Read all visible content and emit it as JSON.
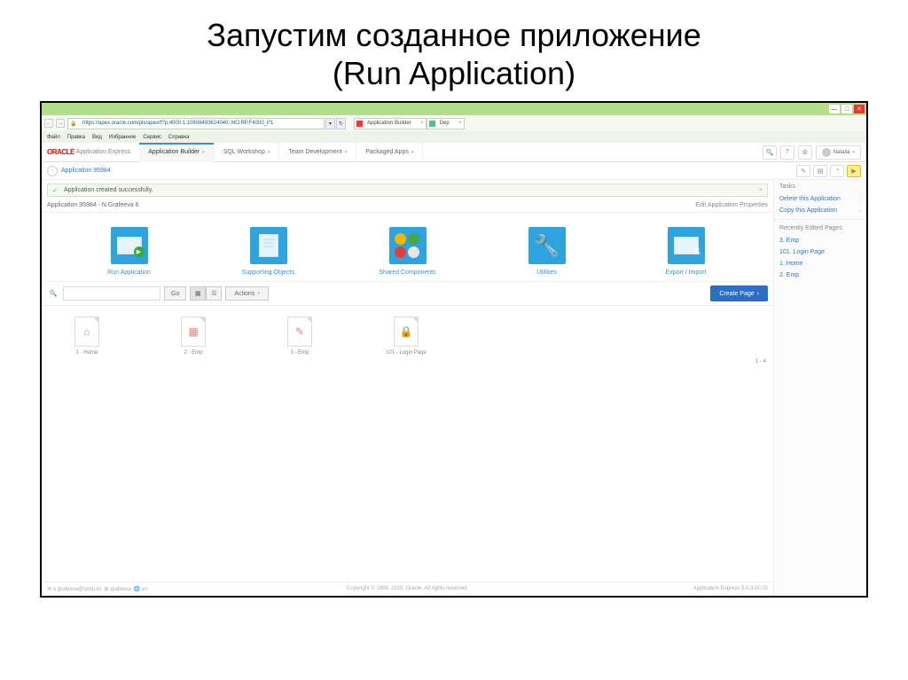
{
  "slide": {
    "title_ru": "Запустим созданное приложение",
    "title_en": "(Run Application)"
  },
  "browser": {
    "url": "https://apex.oracle.com/pls/apex/f?p;4000:1:10808493624040::NO:RP,F4000_P1",
    "tabs": [
      {
        "label": "Application Builder"
      },
      {
        "label": "Dep"
      }
    ],
    "menu": [
      "Файл",
      "Правка",
      "Вид",
      "Избранное",
      "Сервис",
      "Справка"
    ]
  },
  "apex": {
    "logo": "ORACLE",
    "product": "Application Express",
    "tabs": [
      {
        "label": "Application Builder"
      },
      {
        "label": "SQL Workshop"
      },
      {
        "label": "Team Development"
      },
      {
        "label": "Packaged Apps"
      }
    ],
    "user": "Natalia",
    "breadcrumb": "Application 95984",
    "success": "Application created successfully.",
    "app_title": "Application 95984 - N.Grafeeva 6",
    "edit_props": "Edit Application Properties",
    "tiles": [
      {
        "label": "Run Application"
      },
      {
        "label": "Supporting Objects"
      },
      {
        "label": "Shared Components"
      },
      {
        "label": "Utilities"
      },
      {
        "label": "Export / Import"
      }
    ],
    "toolbar": {
      "go": "Go",
      "actions": "Actions",
      "create": "Create Page"
    },
    "pages": [
      {
        "label": "1 - Home"
      },
      {
        "label": "2 - Emp"
      },
      {
        "label": "3 - Emp"
      },
      {
        "label": "101 - Login Page"
      }
    ],
    "page_count": "1 - 4",
    "footer": {
      "left_user": "n.grafeeva@spbu.ru",
      "left_ws": "grafeeva",
      "left_lang": "en",
      "center": "Copyright © 1999, 2015, Oracle. All rights reserved.",
      "right": "Application Express 5.0.3.00.03"
    },
    "side": {
      "tasks_head": "Tasks",
      "links": [
        "Delete this Application",
        "Copy this Application"
      ],
      "recent_head": "Recently Edited Pages",
      "recent": [
        "3. Emp",
        "101. Login Page",
        "1. Home",
        "2. Emp"
      ]
    }
  }
}
